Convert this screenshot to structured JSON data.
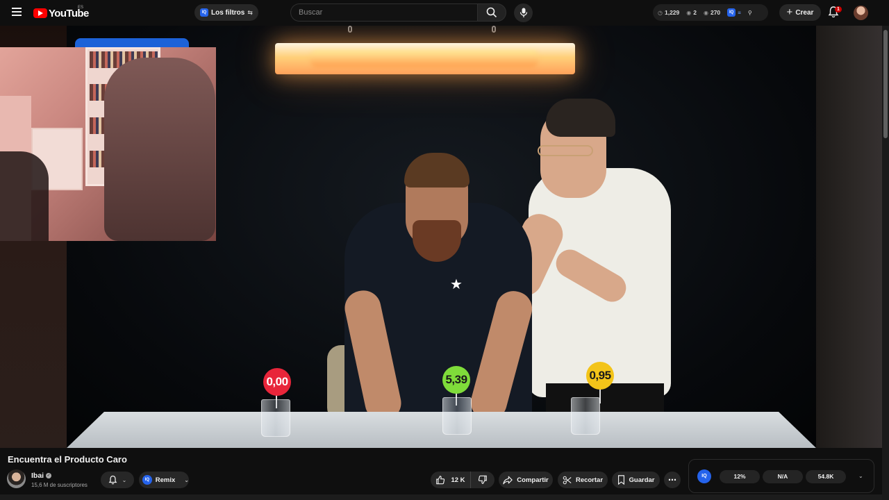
{
  "header": {
    "logo_text": "YouTube",
    "region": "ES",
    "filters_label": "Los filtros",
    "filters_badge": "IQ",
    "search_placeholder": "Buscar",
    "stats": {
      "watch_count": "1,229",
      "eye_count": "2",
      "view_count": "270",
      "badge": "IQ"
    },
    "create_label": "Crear",
    "notification_count": "1"
  },
  "video": {
    "price_tags": [
      {
        "label": "0,00",
        "color": "#e8253a"
      },
      {
        "label": "5,39",
        "color": "#7fdc3a"
      },
      {
        "label": "0,95",
        "color": "#f3c419"
      }
    ]
  },
  "info": {
    "title": "Encuentra el Producto Caro",
    "channel": {
      "name": "Ibai",
      "subscribers": "15,6 M de suscriptores"
    },
    "remix_label": "Remix",
    "remix_badge": "IQ",
    "likes": "12 K",
    "share_label": "Compartir",
    "clip_label": "Recortar",
    "save_label": "Guardar"
  },
  "iq_panel": {
    "badge": "IQ",
    "metrics": [
      "12%",
      "N/A",
      "54.8K"
    ]
  },
  "colors": {
    "background": "#0f0f0f",
    "pill": "#272727",
    "brand_red": "#ff0000",
    "iq_blue": "#2563eb"
  }
}
